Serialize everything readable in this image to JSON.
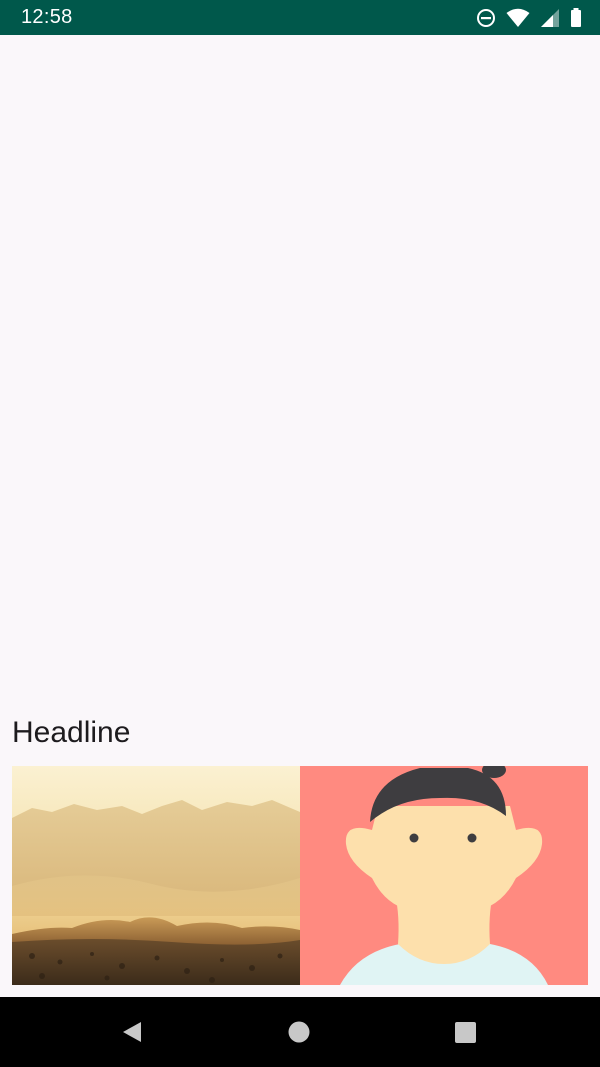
{
  "status_bar": {
    "time": "12:58",
    "background": "#00584b",
    "icons": [
      "do-not-disturb-icon",
      "wifi-icon",
      "cell-signal-icon",
      "battery-icon"
    ]
  },
  "main": {
    "headline": "Headline",
    "images": [
      {
        "name": "desert-dunes-image"
      },
      {
        "name": "person-avatar-illustration"
      }
    ]
  },
  "nav_bar": {
    "buttons": [
      "back-button",
      "home-button",
      "recents-button"
    ]
  }
}
